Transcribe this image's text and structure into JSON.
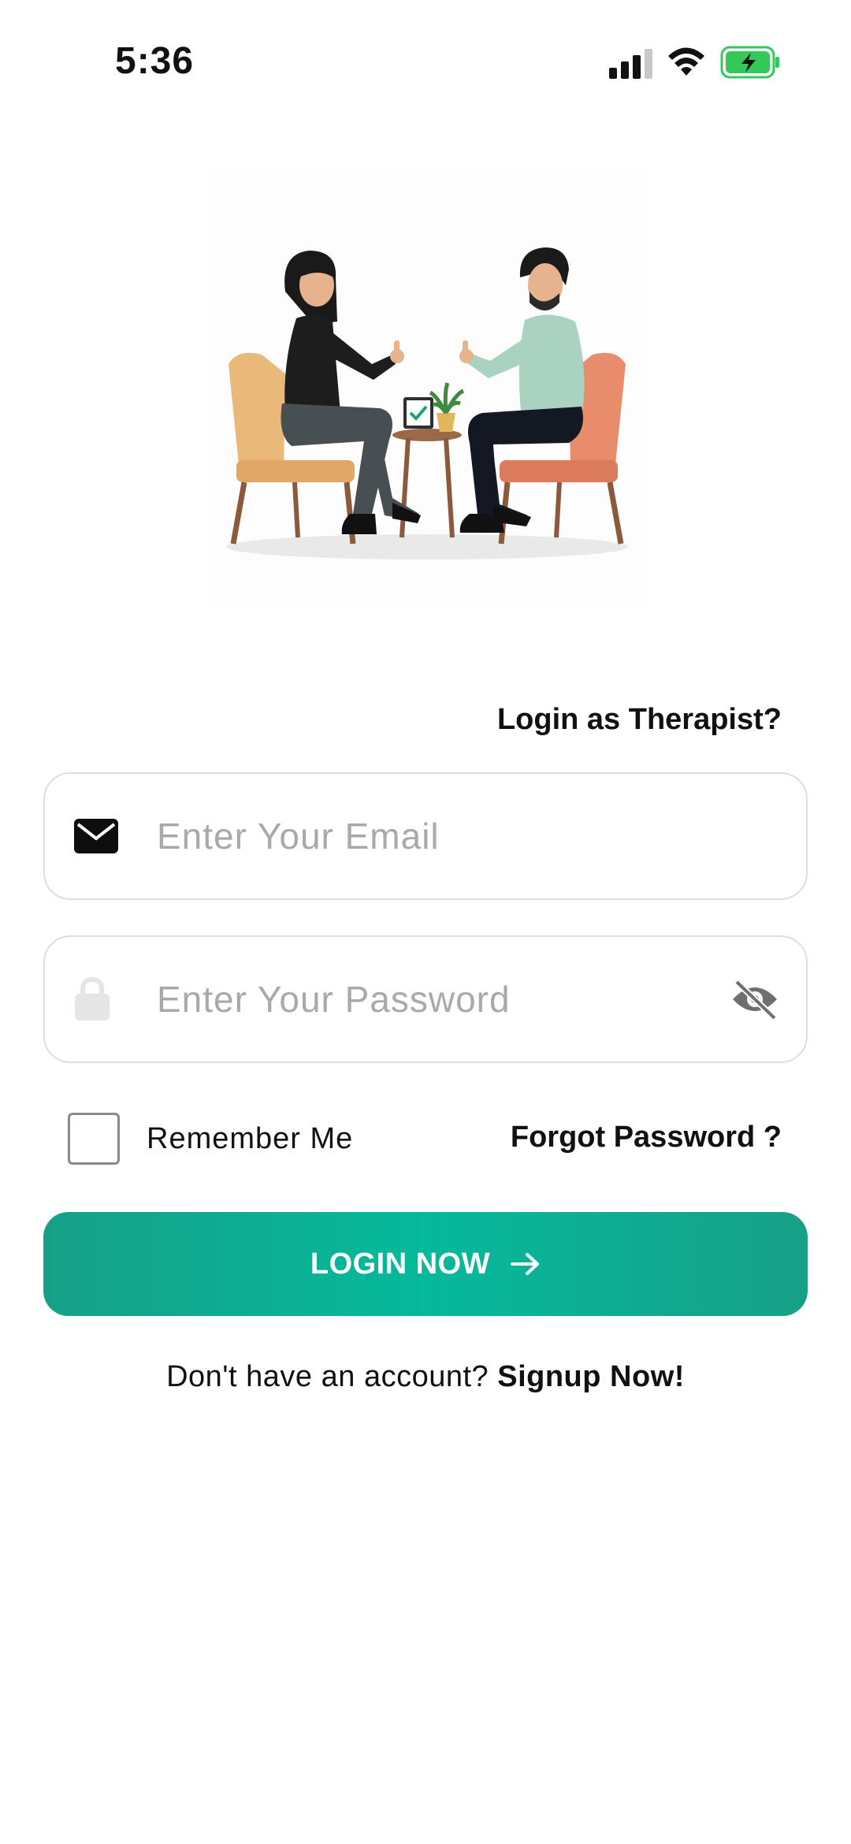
{
  "status_bar": {
    "time": "5:36"
  },
  "login": {
    "therapist_link": "Login as Therapist?",
    "email_placeholder": "Enter Your Email",
    "password_placeholder": "Enter Your Password",
    "remember_label": "Remember Me",
    "forgot_label": "Forgot Password ?",
    "login_button": "LOGIN NOW",
    "signup_prompt": "Don't have an account?",
    "signup_link": "Signup Now!"
  },
  "colors": {
    "accent": "#06b99b",
    "accent_dark": "#16a088",
    "battery": "#34c759"
  },
  "icons": [
    "signal-icon",
    "wifi-icon",
    "battery-icon",
    "mail-icon",
    "lock-icon",
    "eye-off-icon",
    "arrow-right-icon"
  ]
}
